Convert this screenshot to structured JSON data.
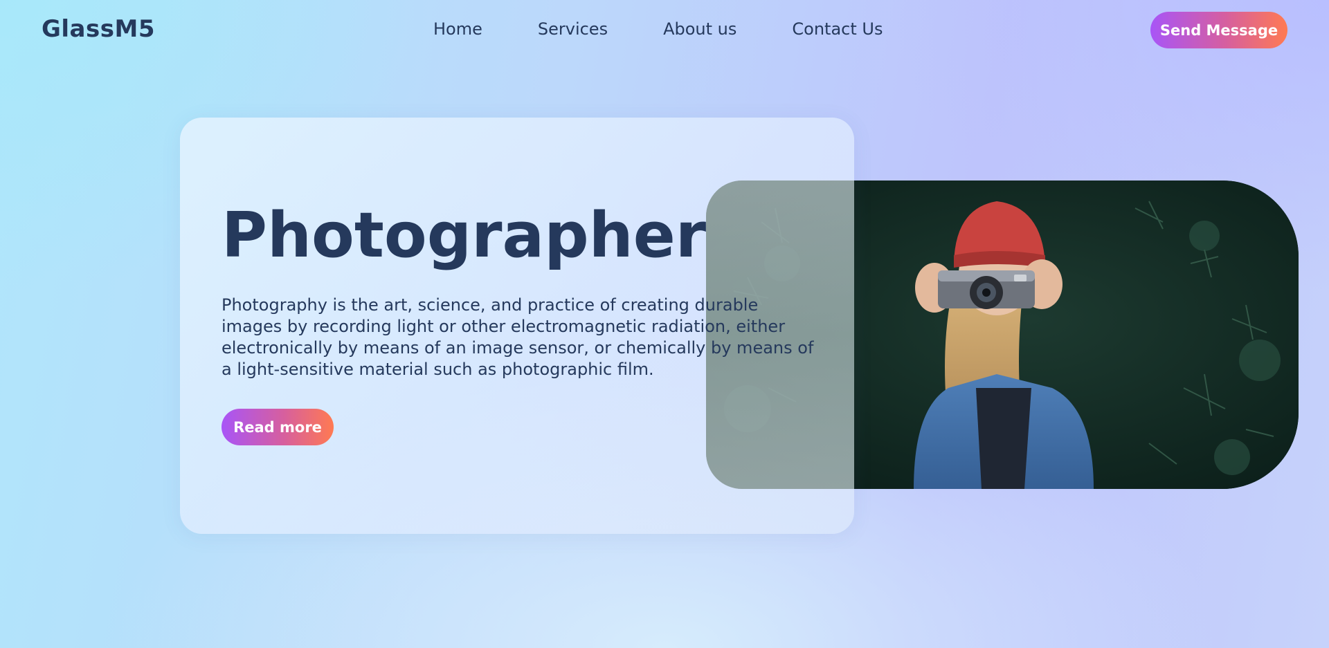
{
  "header": {
    "logo": "GlassM5",
    "nav": [
      {
        "label": "Home"
      },
      {
        "label": "Services"
      },
      {
        "label": "About us"
      },
      {
        "label": "Contact Us"
      }
    ],
    "cta_label": "Send Message"
  },
  "hero": {
    "title": "Photographer",
    "description": "Photography is the art, science, and practice of creating durable images by recording light or other electromagnetic radiation, either electronically by means of an image sensor, or chemically by means of a light-sensitive material such as photographic film.",
    "button_label": "Read more",
    "image": "photographer-with-camera"
  },
  "colors": {
    "text": "#25395c",
    "button_gradient_start": "#a855f7",
    "button_gradient_end": "#ff7a52"
  }
}
